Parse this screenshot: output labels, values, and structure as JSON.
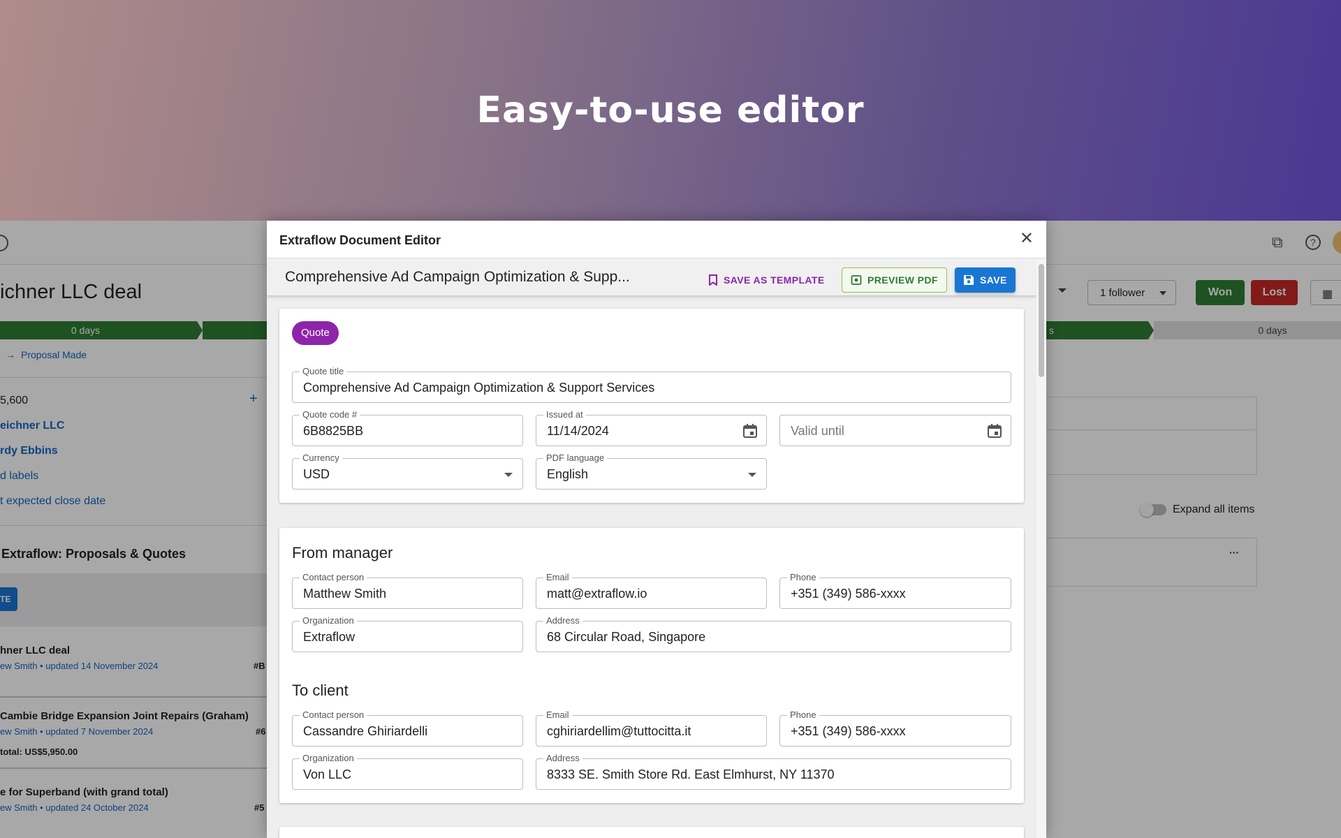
{
  "hero": {
    "title": "Easy-to-use editor"
  },
  "background": {
    "deal_title": "ichner LLC deal",
    "stage_left_days": "0 days",
    "stage_right_label": "s",
    "stage_far_right_days": "0 days",
    "stage_link": "Proposal Made",
    "amount": "5,600",
    "org_link": "eichner LLC",
    "person_link": "rdy Ebbins",
    "labels_link": "d labels",
    "close_date_link": "t expected close date",
    "panel_title": "Extraflow: Proposals & Quotes",
    "create_button": "TE",
    "items": [
      {
        "title": "hner LLC deal",
        "meta": "ew Smith • updated 14 November 2024",
        "code": "#B",
        "total": ""
      },
      {
        "title": "Cambie Bridge Expansion Joint Repairs (Graham)",
        "meta": "ew Smith • updated 7 November 2024",
        "code": "#6",
        "total": "total: US$5,950.00"
      },
      {
        "title": "e for Superband (with grand total)",
        "meta": "ew Smith • updated 24 October 2024",
        "code": "#5",
        "total": ""
      }
    ],
    "follower_button": "1 follower",
    "won_button": "Won",
    "lost_button": "Lost",
    "expand_label": "Expand all items",
    "more_label": "···",
    "colors": {
      "won": "#2e7d32",
      "lost": "#c62828",
      "stage": "#2e7d32"
    }
  },
  "editor": {
    "window_title": "Extraflow Document Editor",
    "doc_title": "Comprehensive Ad Campaign Optimization & Supp...",
    "save_template_label": "SAVE AS TEMPLATE",
    "preview_label": "PREVIEW PDF",
    "save_label": "SAVE",
    "doc_type": "Quote",
    "fields": {
      "quote_title": {
        "label": "Quote title",
        "value": "Comprehensive Ad Campaign Optimization & Support Services"
      },
      "quote_code": {
        "label": "Quote code #",
        "value": "6B8825BB"
      },
      "issued_at": {
        "label": "Issued at",
        "value": "11/14/2024"
      },
      "valid_until": {
        "placeholder": "Valid until"
      },
      "currency": {
        "label": "Currency",
        "value": "USD"
      },
      "pdf_language": {
        "label": "PDF language",
        "value": "English"
      }
    },
    "from_manager": {
      "heading": "From manager",
      "contact": {
        "label": "Contact person",
        "value": "Matthew Smith"
      },
      "email": {
        "label": "Email",
        "value": "matt@extraflow.io"
      },
      "phone": {
        "label": "Phone",
        "value": "+351 (349) 586-xxxx"
      },
      "organization": {
        "label": "Organization",
        "value": "Extraflow"
      },
      "address": {
        "label": "Address",
        "value": "68 Circular Road, Singapore"
      }
    },
    "to_client": {
      "heading": "To client",
      "contact": {
        "label": "Contact person",
        "value": "Cassandre Ghiriardelli"
      },
      "email": {
        "label": "Email",
        "value": "cghiriardellim@tuttocitta.it"
      },
      "phone": {
        "label": "Phone",
        "value": "+351 (349) 586-xxxx"
      },
      "organization": {
        "label": "Organization",
        "value": "Von LLC"
      },
      "address": {
        "label": "Address",
        "value": "8333 SE. Smith Store Rd. East Elmhurst, NY 11370"
      }
    },
    "colors": {
      "accent_purple": "#8e24aa",
      "save_blue": "#1976d2",
      "preview_green": "#2e7d32"
    }
  }
}
